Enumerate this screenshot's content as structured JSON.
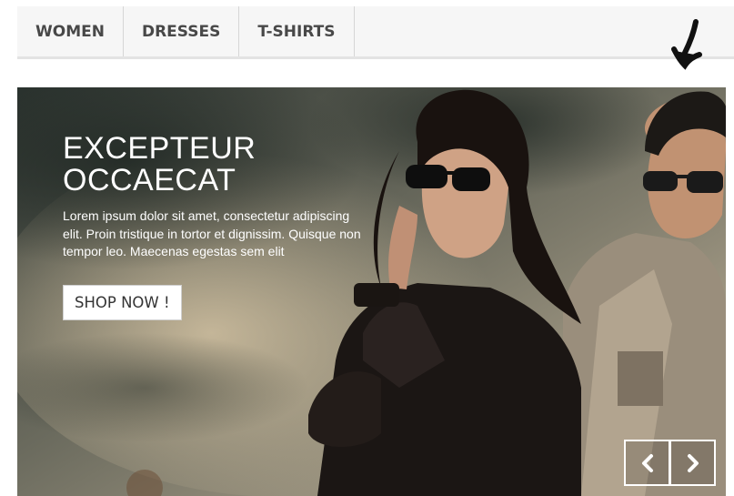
{
  "nav": {
    "items": [
      {
        "label": "Women"
      },
      {
        "label": "Dresses"
      },
      {
        "label": "T-shirts"
      }
    ]
  },
  "hero": {
    "title_line1": "Excepteur",
    "title_line2": "Occaecat",
    "text": "Lorem ipsum dolor sit amet, consectetur adipiscing elit. Proin tristique in tortor et dignissim. Quisque non tempor leo. Maecenas egestas sem elit",
    "button_label": "Shop now !",
    "prev_icon": "chevron-left-icon",
    "next_icon": "chevron-right-icon"
  },
  "colors": {
    "nav_background": "#f6f6f6",
    "nav_text": "#484848",
    "hero_text": "#ffffff",
    "button_background": "#ffffff"
  }
}
